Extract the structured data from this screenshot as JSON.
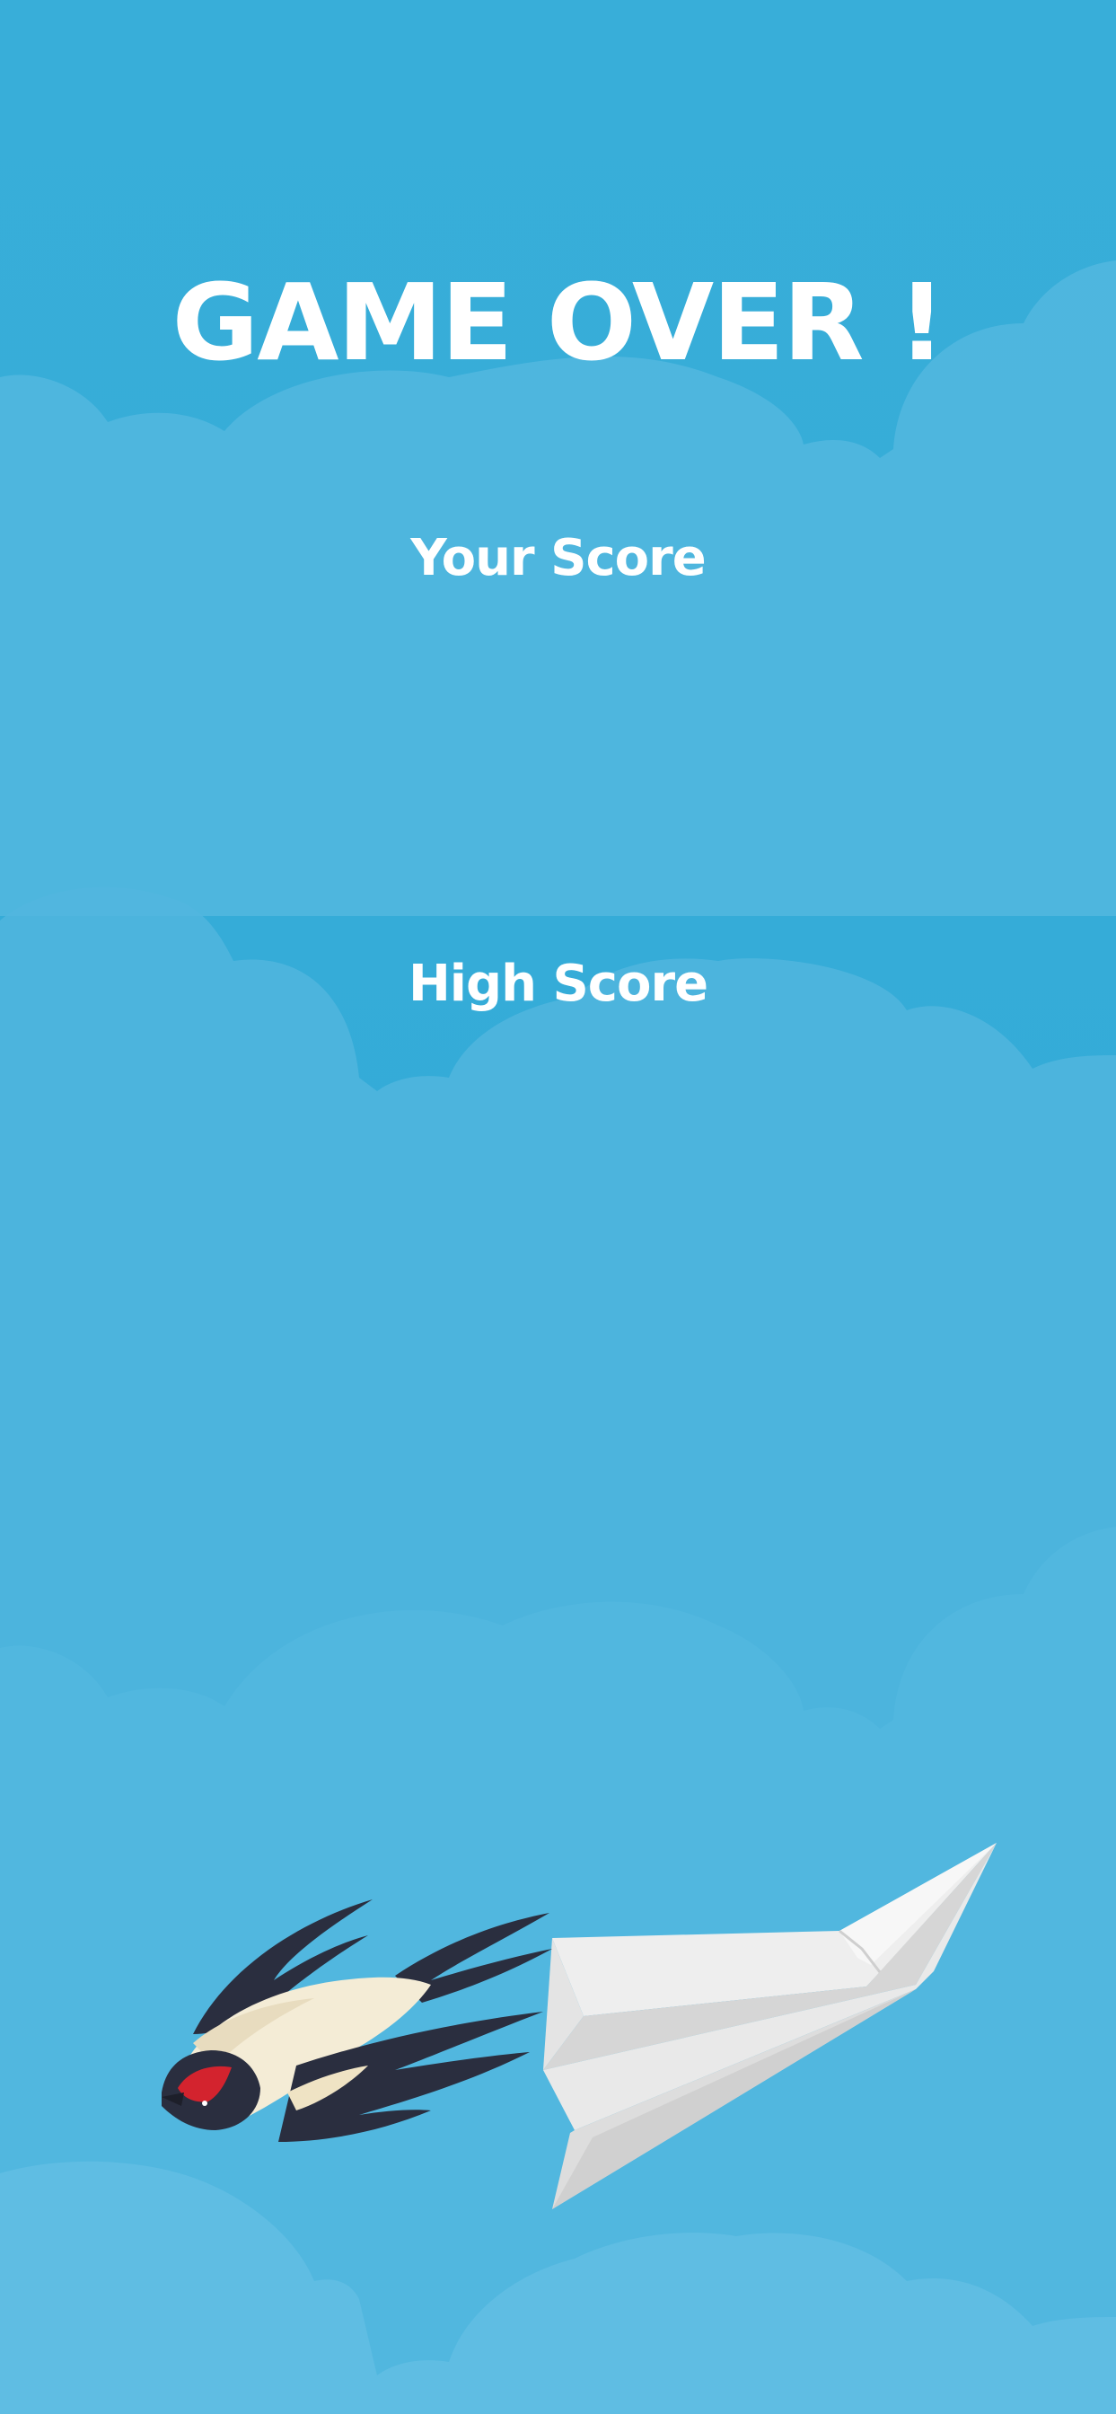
{
  "game": {
    "title": "GAME OVER !",
    "your_score_label": "Your Score",
    "your_score_value": "",
    "high_score_label": "High Score",
    "high_score_value": ""
  },
  "sprites": {
    "player": "paper-plane",
    "enemy": "swallow-bird"
  },
  "colors": {
    "sky": "#33aad8",
    "cloud": "#52b7df",
    "text": "#ffffff",
    "plane_light": "#f1f1f1",
    "plane_shadow": "#cfcfcf",
    "bird_dark": "#2a2e3f",
    "bird_belly": "#f4ecd6",
    "bird_face": "#d3232e"
  }
}
